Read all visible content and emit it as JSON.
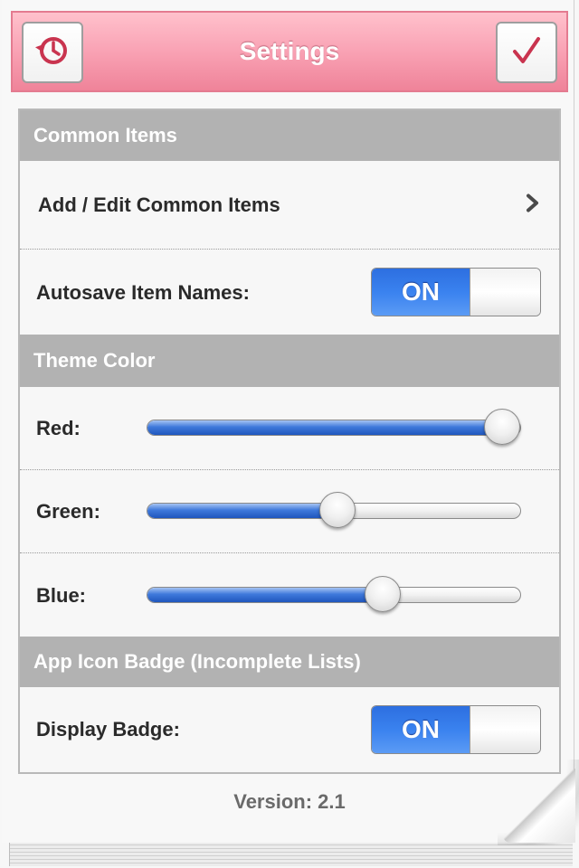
{
  "header": {
    "title": "Settings",
    "left_icon": "history-icon",
    "right_icon": "checkmark-icon",
    "accent_color": "#f59aae"
  },
  "sections": {
    "common": {
      "title": "Common Items",
      "add_edit_label": "Add / Edit Common Items",
      "autosave_label": "Autosave Item Names:",
      "autosave_value": "ON"
    },
    "theme": {
      "title": "Theme Color",
      "red_label": "Red:",
      "green_label": "Green:",
      "blue_label": "Blue:",
      "red_level": 0.95,
      "green_level": 0.51,
      "blue_level": 0.63
    },
    "badge": {
      "title": "App Icon Badge (Incomplete Lists)",
      "display_label": "Display Badge:",
      "display_value": "ON"
    }
  },
  "footer": {
    "version": "Version: 2.1"
  },
  "colors": {
    "switch_on": "#3a82ef",
    "section_header": "#b2b2b2"
  }
}
